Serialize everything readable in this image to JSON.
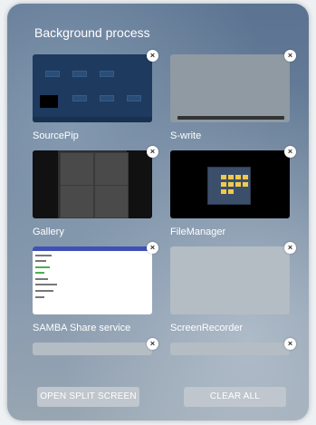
{
  "header": {
    "title": "Background process"
  },
  "apps": [
    {
      "name": "SourcePip"
    },
    {
      "name": "S-write"
    },
    {
      "name": "Gallery"
    },
    {
      "name": "FileManager"
    },
    {
      "name": "SAMBA Share service"
    },
    {
      "name": "ScreenRecorder"
    }
  ],
  "close_icon": "×",
  "footer": {
    "split_label": "OPEN SPLIT SCREEN",
    "clear_label": "CLEAR ALL"
  },
  "colors": {
    "panel_top": "#5b7391",
    "button_bg": "#bfc6cd"
  }
}
